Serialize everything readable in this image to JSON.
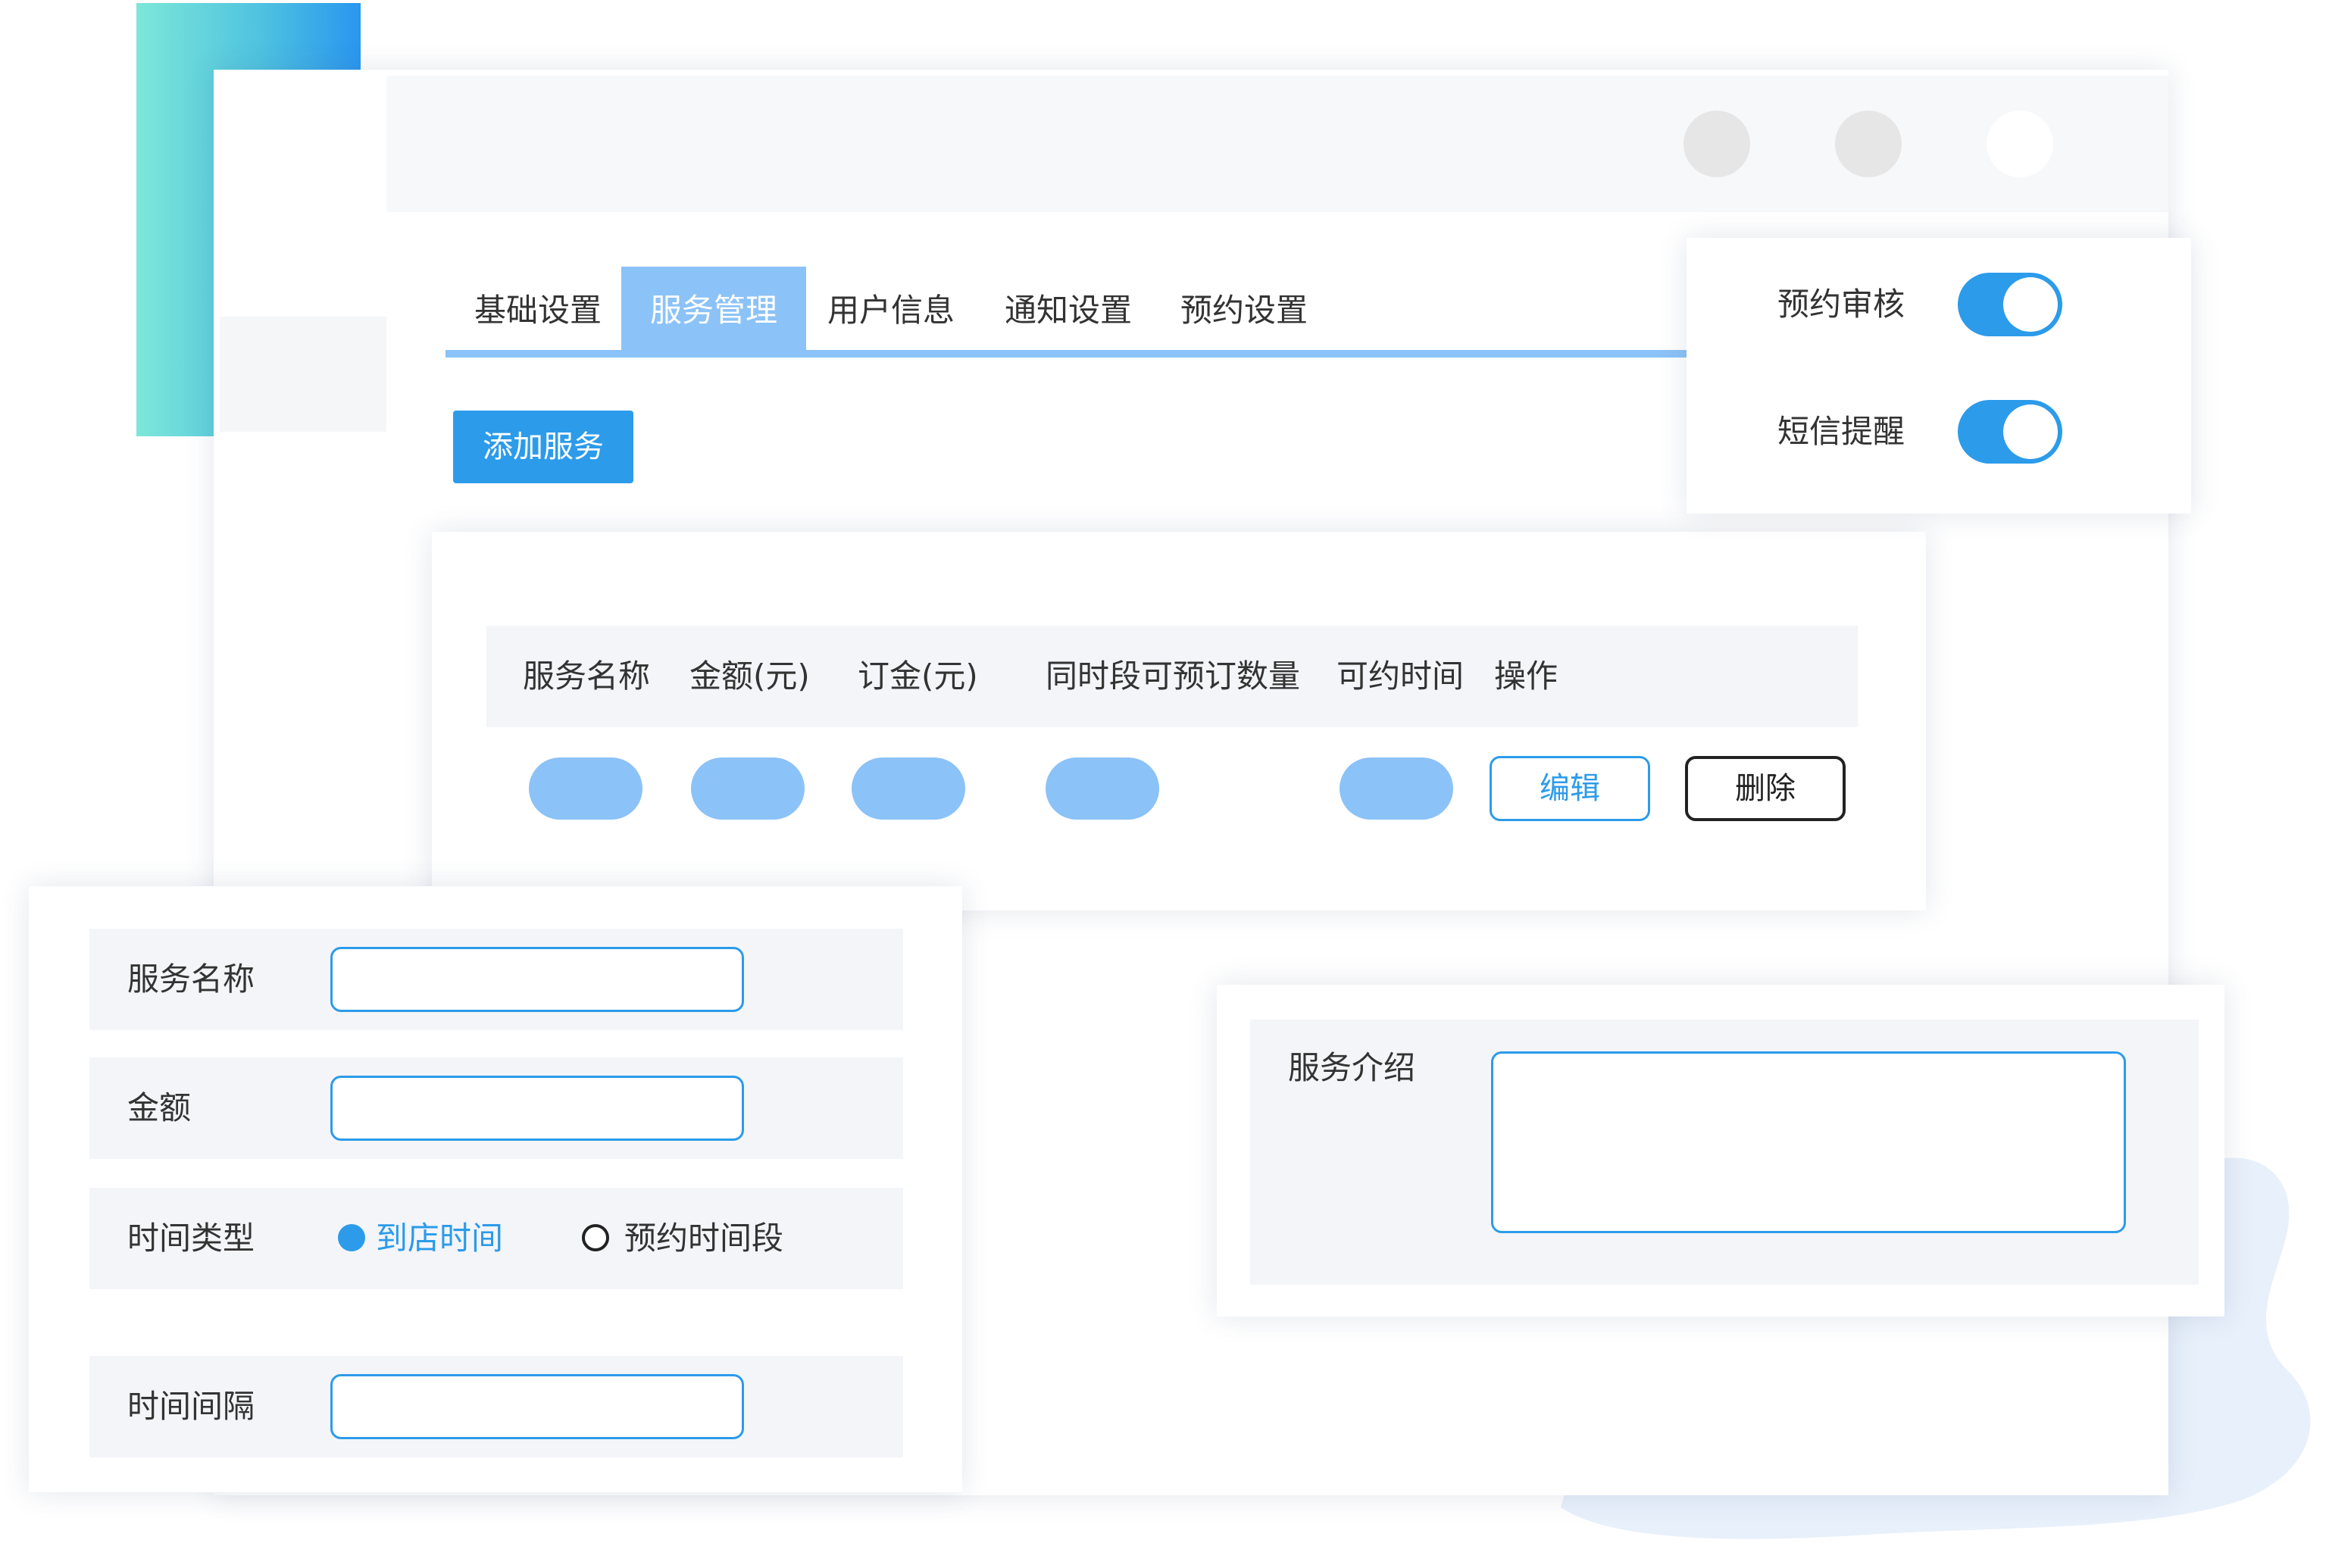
{
  "tabs": [
    {
      "label": "基础设置"
    },
    {
      "label": "服务管理"
    },
    {
      "label": "用户信息"
    },
    {
      "label": "通知设置"
    },
    {
      "label": "预约设置"
    }
  ],
  "active_tab": "服务管理",
  "add_button": "添加服务",
  "toggles": [
    {
      "label": "预约审核",
      "on": true
    },
    {
      "label": "短信提醒",
      "on": true
    }
  ],
  "table": {
    "columns": [
      "服务名称",
      "金额(元)",
      "订金(元)",
      "同时段可预订数量",
      "可约时间",
      "操作"
    ],
    "actions": {
      "edit": "编辑",
      "delete": "删除"
    }
  },
  "form": {
    "service_name": {
      "label": "服务名称",
      "value": ""
    },
    "amount": {
      "label": "金额",
      "value": ""
    },
    "time_type": {
      "label": "时间类型",
      "options": [
        "到店时间",
        "预约时间段"
      ],
      "selected": "到店时间"
    },
    "interval": {
      "label": "时间间隔",
      "value": ""
    }
  },
  "intro": {
    "label": "服务介绍",
    "value": ""
  },
  "colors": {
    "accent": "#2c9bea",
    "tab_active": "#8bc2f7",
    "row_bg": "#f4f5f9",
    "header_bg": "#f7f8fa"
  }
}
